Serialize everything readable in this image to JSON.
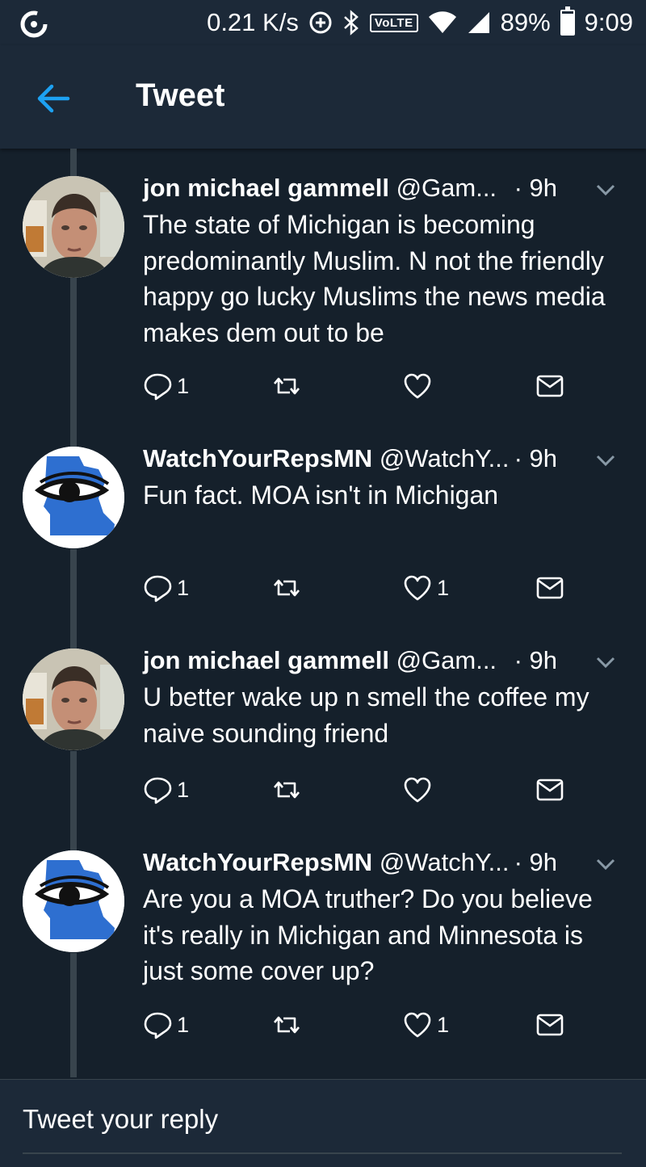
{
  "status_bar": {
    "speed": "0.21 K/s",
    "volte": "VoLTE",
    "battery": "89%",
    "battery_level": 0.89,
    "time": "9:09",
    "icons": [
      "sync-icon",
      "data-saver-icon",
      "bluetooth-icon",
      "wifi-icon",
      "signal-icon",
      "battery-icon"
    ]
  },
  "header": {
    "title": "Tweet",
    "back_icon": "back-arrow-icon"
  },
  "tweets": [
    {
      "name": "jon michael gammell",
      "handle": "@Gam...",
      "time": "· 9h",
      "text": "The state of Michigan is becoming predominantly Muslim. N not the friendly happy go lucky Muslims the news media makes dem out to be",
      "replies": "1",
      "retweets": "",
      "likes": ""
    },
    {
      "name": "WatchYourRepsMN",
      "handle": "@WatchY...",
      "time": "· 9h",
      "text": "Fun fact. MOA isn't in Michigan",
      "replies": "1",
      "retweets": "",
      "likes": "1"
    },
    {
      "name": "jon michael gammell",
      "handle": "@Gam...",
      "time": "· 9h",
      "text": "U better wake up n smell the coffee my naive sounding friend",
      "replies": "1",
      "retweets": "",
      "likes": ""
    },
    {
      "name": "WatchYourRepsMN",
      "handle": "@WatchY...",
      "time": "· 9h",
      "text": "Are you a MOA truther? Do you believe it's really in Michigan and Minnesota is just some cover up?",
      "replies": "1",
      "retweets": "",
      "likes": "1"
    }
  ],
  "reply_bar": {
    "placeholder": "Tweet your reply"
  },
  "colors": {
    "background": "#15202b",
    "bar": "#1c2938",
    "accent": "#1da1f2",
    "divider": "#38444d"
  }
}
